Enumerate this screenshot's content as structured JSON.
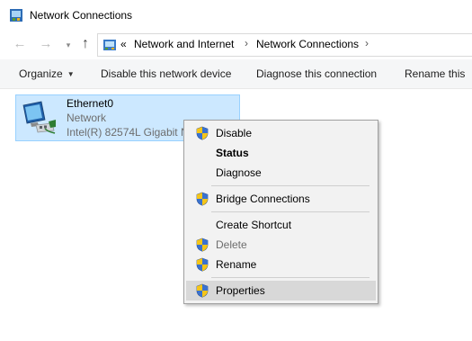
{
  "window": {
    "title": "Network Connections",
    "icon": "network-connections-icon"
  },
  "address_bar": {
    "back_icon": "arrow-left-icon",
    "forward_icon": "arrow-right-icon",
    "recent_icon": "chevron-down-icon",
    "up_icon": "arrow-up-icon",
    "location_icon": "control-panel-icon",
    "overflow": "«",
    "breadcrumbs": [
      "Network and Internet",
      "Network Connections"
    ],
    "separator": "›"
  },
  "toolbar": {
    "organize": "Organize",
    "disable_device": "Disable this network device",
    "diagnose": "Diagnose this connection",
    "rename": "Rename this"
  },
  "connection": {
    "name": "Ethernet0",
    "status": "Network",
    "device": "Intel(R) 82574L Gigabit N",
    "icon": "ethernet-adapter-icon"
  },
  "context_menu": {
    "items": [
      {
        "label": "Disable",
        "shield": true
      },
      {
        "label": "Status",
        "shield": false,
        "bold": true
      },
      {
        "label": "Diagnose",
        "shield": false
      },
      {
        "label": "Bridge Connections",
        "shield": true
      },
      {
        "label": "Create Shortcut",
        "shield": false
      },
      {
        "label": "Delete",
        "shield": true,
        "disabled": true
      },
      {
        "label": "Rename",
        "shield": true
      },
      {
        "label": "Properties",
        "shield": true,
        "highlighted": true
      }
    ]
  },
  "colors": {
    "selection_fill": "#cce8ff",
    "selection_border": "#99d1ff",
    "toolbar_bg": "#f5f6f7",
    "menu_bg": "#f2f2f2",
    "menu_highlight": "#d8d8d8",
    "shield_blue": "#2f5fb3",
    "shield_yellow": "#f5c518"
  }
}
